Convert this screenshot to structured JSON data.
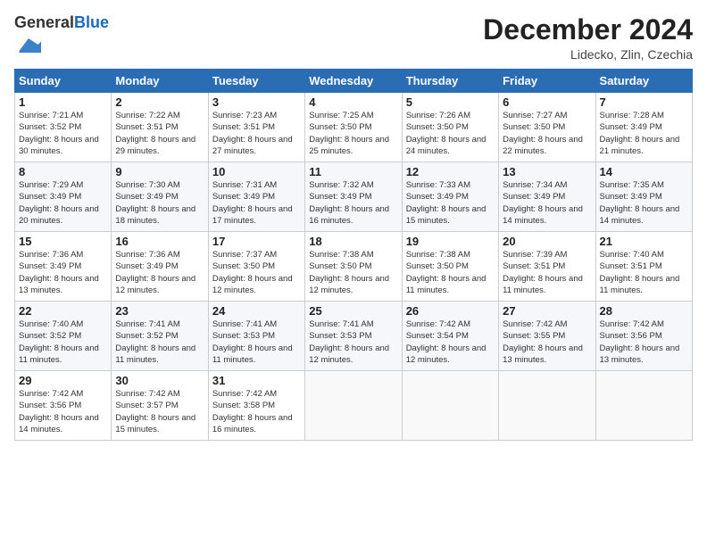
{
  "logo": {
    "general": "General",
    "blue": "Blue"
  },
  "title": "December 2024",
  "location": "Lidecko, Zlin, Czechia",
  "weekdays": [
    "Sunday",
    "Monday",
    "Tuesday",
    "Wednesday",
    "Thursday",
    "Friday",
    "Saturday"
  ],
  "weeks": [
    [
      {
        "day": "1",
        "sunrise": "7:21 AM",
        "sunset": "3:52 PM",
        "daylight": "8 hours and 30 minutes."
      },
      {
        "day": "2",
        "sunrise": "7:22 AM",
        "sunset": "3:51 PM",
        "daylight": "8 hours and 29 minutes."
      },
      {
        "day": "3",
        "sunrise": "7:23 AM",
        "sunset": "3:51 PM",
        "daylight": "8 hours and 27 minutes."
      },
      {
        "day": "4",
        "sunrise": "7:25 AM",
        "sunset": "3:50 PM",
        "daylight": "8 hours and 25 minutes."
      },
      {
        "day": "5",
        "sunrise": "7:26 AM",
        "sunset": "3:50 PM",
        "daylight": "8 hours and 24 minutes."
      },
      {
        "day": "6",
        "sunrise": "7:27 AM",
        "sunset": "3:50 PM",
        "daylight": "8 hours and 22 minutes."
      },
      {
        "day": "7",
        "sunrise": "7:28 AM",
        "sunset": "3:49 PM",
        "daylight": "8 hours and 21 minutes."
      }
    ],
    [
      {
        "day": "8",
        "sunrise": "7:29 AM",
        "sunset": "3:49 PM",
        "daylight": "8 hours and 20 minutes."
      },
      {
        "day": "9",
        "sunrise": "7:30 AM",
        "sunset": "3:49 PM",
        "daylight": "8 hours and 18 minutes."
      },
      {
        "day": "10",
        "sunrise": "7:31 AM",
        "sunset": "3:49 PM",
        "daylight": "8 hours and 17 minutes."
      },
      {
        "day": "11",
        "sunrise": "7:32 AM",
        "sunset": "3:49 PM",
        "daylight": "8 hours and 16 minutes."
      },
      {
        "day": "12",
        "sunrise": "7:33 AM",
        "sunset": "3:49 PM",
        "daylight": "8 hours and 15 minutes."
      },
      {
        "day": "13",
        "sunrise": "7:34 AM",
        "sunset": "3:49 PM",
        "daylight": "8 hours and 14 minutes."
      },
      {
        "day": "14",
        "sunrise": "7:35 AM",
        "sunset": "3:49 PM",
        "daylight": "8 hours and 14 minutes."
      }
    ],
    [
      {
        "day": "15",
        "sunrise": "7:36 AM",
        "sunset": "3:49 PM",
        "daylight": "8 hours and 13 minutes."
      },
      {
        "day": "16",
        "sunrise": "7:36 AM",
        "sunset": "3:49 PM",
        "daylight": "8 hours and 12 minutes."
      },
      {
        "day": "17",
        "sunrise": "7:37 AM",
        "sunset": "3:50 PM",
        "daylight": "8 hours and 12 minutes."
      },
      {
        "day": "18",
        "sunrise": "7:38 AM",
        "sunset": "3:50 PM",
        "daylight": "8 hours and 12 minutes."
      },
      {
        "day": "19",
        "sunrise": "7:38 AM",
        "sunset": "3:50 PM",
        "daylight": "8 hours and 11 minutes."
      },
      {
        "day": "20",
        "sunrise": "7:39 AM",
        "sunset": "3:51 PM",
        "daylight": "8 hours and 11 minutes."
      },
      {
        "day": "21",
        "sunrise": "7:40 AM",
        "sunset": "3:51 PM",
        "daylight": "8 hours and 11 minutes."
      }
    ],
    [
      {
        "day": "22",
        "sunrise": "7:40 AM",
        "sunset": "3:52 PM",
        "daylight": "8 hours and 11 minutes."
      },
      {
        "day": "23",
        "sunrise": "7:41 AM",
        "sunset": "3:52 PM",
        "daylight": "8 hours and 11 minutes."
      },
      {
        "day": "24",
        "sunrise": "7:41 AM",
        "sunset": "3:53 PM",
        "daylight": "8 hours and 11 minutes."
      },
      {
        "day": "25",
        "sunrise": "7:41 AM",
        "sunset": "3:53 PM",
        "daylight": "8 hours and 12 minutes."
      },
      {
        "day": "26",
        "sunrise": "7:42 AM",
        "sunset": "3:54 PM",
        "daylight": "8 hours and 12 minutes."
      },
      {
        "day": "27",
        "sunrise": "7:42 AM",
        "sunset": "3:55 PM",
        "daylight": "8 hours and 13 minutes."
      },
      {
        "day": "28",
        "sunrise": "7:42 AM",
        "sunset": "3:56 PM",
        "daylight": "8 hours and 13 minutes."
      }
    ],
    [
      {
        "day": "29",
        "sunrise": "7:42 AM",
        "sunset": "3:56 PM",
        "daylight": "8 hours and 14 minutes."
      },
      {
        "day": "30",
        "sunrise": "7:42 AM",
        "sunset": "3:57 PM",
        "daylight": "8 hours and 15 minutes."
      },
      {
        "day": "31",
        "sunrise": "7:42 AM",
        "sunset": "3:58 PM",
        "daylight": "8 hours and 16 minutes."
      },
      null,
      null,
      null,
      null
    ]
  ]
}
